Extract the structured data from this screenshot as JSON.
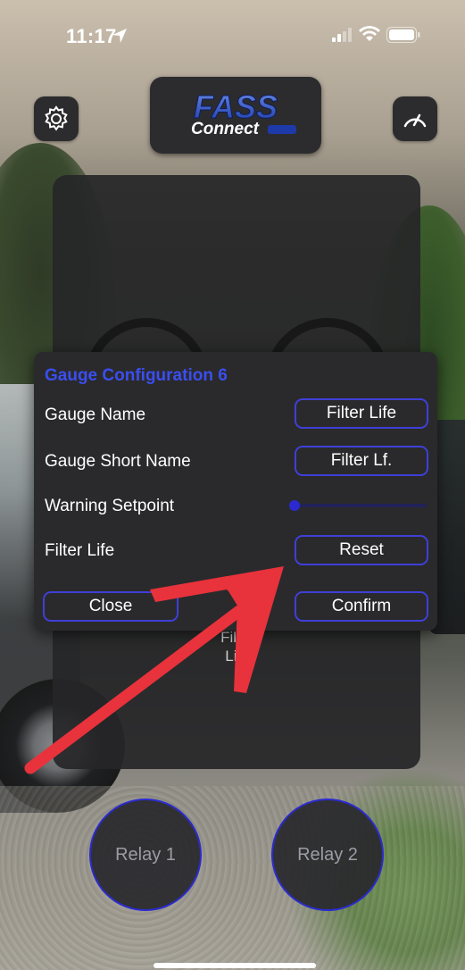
{
  "status_bar": {
    "time": "11:17"
  },
  "header": {
    "logo_text_top": "FASS",
    "logo_text_bottom": "Connect",
    "settings_icon": "gear-icon",
    "gauge_icon": "speedometer-icon"
  },
  "background_gauge": {
    "label": "Filter Life"
  },
  "modal": {
    "title": "Gauge Configuration 6",
    "rows": [
      {
        "label": "Gauge Name",
        "value": "Filter Life"
      },
      {
        "label": "Gauge Short Name",
        "value": "Filter Lf."
      },
      {
        "label": "Warning Setpoint"
      },
      {
        "label": "Filter Life",
        "button": "Reset"
      }
    ],
    "close_label": "Close",
    "confirm_label": "Confirm"
  },
  "relays": [
    {
      "label": "Relay 1"
    },
    {
      "label": "Relay 2"
    }
  ],
  "colors": {
    "accent": "#3f3fd8",
    "title": "#3b4ef0",
    "annotation_arrow": "#e8323c",
    "panel": "#2a2a2c"
  }
}
